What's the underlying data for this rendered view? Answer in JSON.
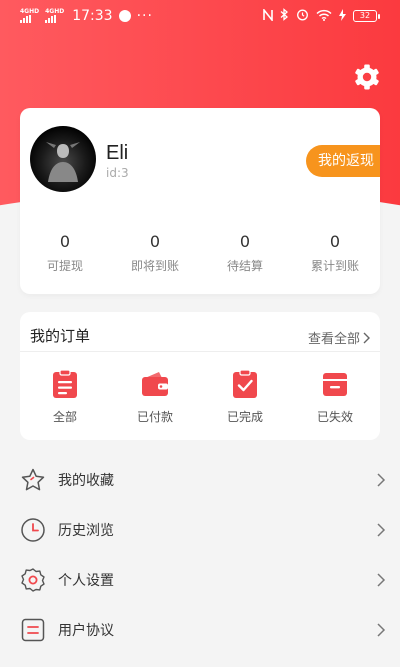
{
  "status_bar": {
    "net1": "4GHD",
    "net2": "4GHD",
    "time": "17:33",
    "more": "···",
    "battery": "32"
  },
  "colors": {
    "primary": "#fb3a3f",
    "accent": "#f7941d",
    "icon_red": "#f0484d"
  },
  "profile": {
    "name": "Eli",
    "id": "id:3",
    "cashback_button": "我的返现",
    "stats": [
      {
        "value": "0",
        "label": "可提现"
      },
      {
        "value": "0",
        "label": "即将到账"
      },
      {
        "value": "0",
        "label": "待结算"
      },
      {
        "value": "0",
        "label": "累计到账"
      }
    ]
  },
  "orders": {
    "title": "我的订单",
    "view_all": "查看全部",
    "items": [
      {
        "label": "全部",
        "icon": "clipboard-list-icon"
      },
      {
        "label": "已付款",
        "icon": "wallet-icon"
      },
      {
        "label": "已完成",
        "icon": "clipboard-check-icon"
      },
      {
        "label": "已失效",
        "icon": "invalid-box-icon"
      }
    ]
  },
  "menu": [
    {
      "label": "我的收藏",
      "icon": "star-icon"
    },
    {
      "label": "历史浏览",
      "icon": "clock-icon"
    },
    {
      "label": "个人设置",
      "icon": "settings-icon"
    },
    {
      "label": "用户协议",
      "icon": "document-icon"
    }
  ]
}
